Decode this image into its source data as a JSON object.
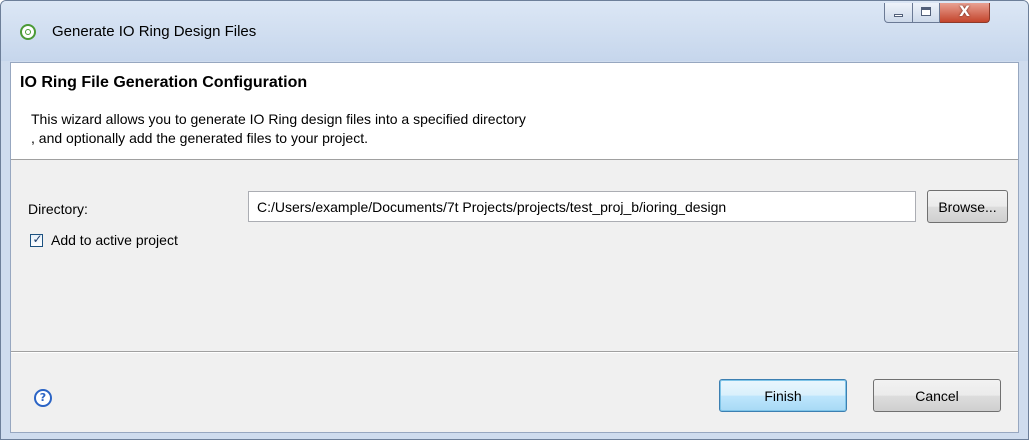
{
  "window": {
    "title": "Generate IO Ring Design Files",
    "icon": "eclipse-wizard-icon",
    "controls": {
      "minimize": "minimize-icon",
      "maximize": "maximize-icon",
      "close": "close-icon",
      "close_glyph": "X"
    }
  },
  "header": {
    "title": "IO Ring File Generation Configuration",
    "description_line1": "This wizard allows you to generate IO Ring design files into a specified directory",
    "description_line2": ", and optionally add the generated files to your project."
  },
  "form": {
    "directory_label": "Directory:",
    "directory_value": "C:/Users/example/Documents/7t Projects/projects/test_proj_b/ioring_design",
    "browse_label": "Browse...",
    "add_to_project_label": "Add to active project",
    "add_to_project_checked": true
  },
  "footer": {
    "help_glyph": "?",
    "finish_label": "Finish",
    "cancel_label": "Cancel"
  },
  "colors": {
    "frame": "#cfdcee",
    "dialog_bg": "#f0f0f0",
    "default_button_border": "#3c7fb1",
    "close_button": "#c4452c"
  }
}
